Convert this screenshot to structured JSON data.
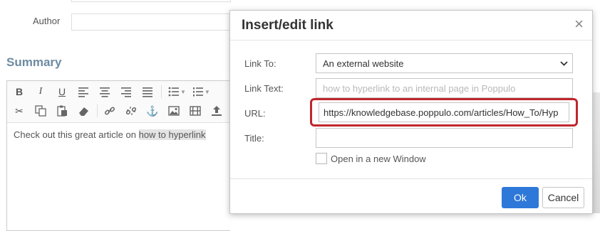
{
  "page": {
    "author_label": "Author",
    "summary_heading": "Summary",
    "editor_text_prefix": "Check out this great article on ",
    "editor_text_selected": "how to hyperlink"
  },
  "toolbar": {
    "row1": [
      "bold-icon",
      "italic-icon",
      "underline-icon",
      "align-left-icon",
      "align-center-icon",
      "align-right-icon",
      "align-justify-icon",
      "bullet-list-icon",
      "numbered-list-icon"
    ],
    "row2": [
      "cut-icon",
      "copy-icon",
      "paste-icon",
      "eraser-icon",
      "link-icon",
      "unlink-icon",
      "anchor-icon",
      "image-icon",
      "media-icon",
      "upload-icon"
    ]
  },
  "dialog": {
    "title": "Insert/edit link",
    "close_glyph": "×",
    "link_to_label": "Link To:",
    "link_to_value": "An external website",
    "link_text_label": "Link Text:",
    "link_text_placeholder": "how to hyperlink to an internal page in Poppulo",
    "url_label": "URL:",
    "url_value": "https://knowledgebase.poppulo.com/articles/How_To/Hyp",
    "title_label": "Title:",
    "title_value": "",
    "new_window_label": "Open in a new Window",
    "new_window_checked": false,
    "ok_label": "Ok",
    "cancel_label": "Cancel",
    "highlight_color": "#c0262d",
    "ok_color": "#2d78d8"
  }
}
